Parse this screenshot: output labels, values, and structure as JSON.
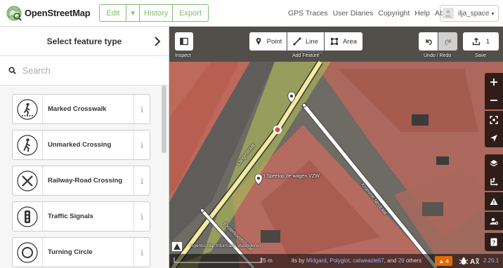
{
  "app": {
    "title": "OpenStreetMap",
    "accent_color": "#7ebc6f",
    "edit_label": "Edit",
    "edit_dropdown": "▾",
    "history_label": "History",
    "export_label": "Export",
    "nav": [
      "GPS Traces",
      "User Diaries",
      "Copyright",
      "Help",
      "About"
    ],
    "username": "ilja_space"
  },
  "sidebar": {
    "title": "Select feature type",
    "search_placeholder": "Search",
    "presets": [
      {
        "label": "Marked Crosswalk",
        "icon": "pedestrian-crosswalk-icon"
      },
      {
        "label": "Unmarked Crossing",
        "icon": "pedestrian-icon"
      },
      {
        "label": "Railway-Road Crossing",
        "icon": "railway-crossing-icon"
      },
      {
        "label": "Traffic Signals",
        "icon": "traffic-signals-icon"
      },
      {
        "label": "Turning Circle",
        "icon": "turning-circle-icon"
      }
    ],
    "info_glyph": "i"
  },
  "map": {
    "toolbar": {
      "inspect_label": "Inspect",
      "point_label": "Point",
      "line_label": "Line",
      "area_label": "Area",
      "add_feature_label": "Add Feature",
      "undo_redo_label": "Undo / Redo",
      "save_count": "1",
      "save_label": "Save"
    },
    "labels": {
      "poi_name": "'t Speelop de wagen VZW",
      "street1": "Langestraat",
      "street2": "Kromme Nestraat",
      "street3": "Eksterboomstraat",
      "imagery_note": "Agentschap Informatie Vlaanderen",
      "obscured_text": "Langestraat"
    },
    "footer": {
      "scale": "25 m",
      "credits_prefix": "its by",
      "contributors": [
        "Midgard",
        "Polyglot",
        "catweazle67"
      ],
      "and_text": ", and",
      "others_count": "29",
      "others_text": "others",
      "warnings": "4",
      "version": "2.20.1"
    }
  }
}
